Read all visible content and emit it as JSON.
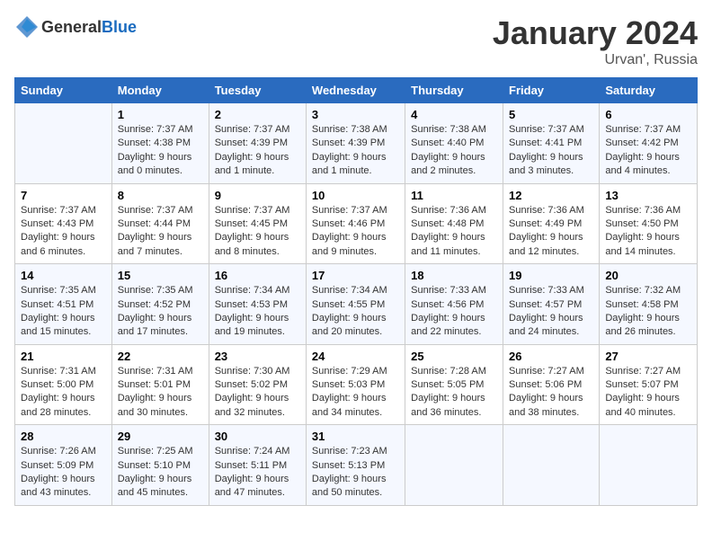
{
  "header": {
    "logo_general": "General",
    "logo_blue": "Blue",
    "month": "January 2024",
    "location": "Urvan', Russia"
  },
  "days_of_week": [
    "Sunday",
    "Monday",
    "Tuesday",
    "Wednesday",
    "Thursday",
    "Friday",
    "Saturday"
  ],
  "weeks": [
    [
      {
        "day": "",
        "info": ""
      },
      {
        "day": "1",
        "info": "Sunrise: 7:37 AM\nSunset: 4:38 PM\nDaylight: 9 hours\nand 0 minutes."
      },
      {
        "day": "2",
        "info": "Sunrise: 7:37 AM\nSunset: 4:39 PM\nDaylight: 9 hours\nand 1 minute."
      },
      {
        "day": "3",
        "info": "Sunrise: 7:38 AM\nSunset: 4:39 PM\nDaylight: 9 hours\nand 1 minute."
      },
      {
        "day": "4",
        "info": "Sunrise: 7:38 AM\nSunset: 4:40 PM\nDaylight: 9 hours\nand 2 minutes."
      },
      {
        "day": "5",
        "info": "Sunrise: 7:37 AM\nSunset: 4:41 PM\nDaylight: 9 hours\nand 3 minutes."
      },
      {
        "day": "6",
        "info": "Sunrise: 7:37 AM\nSunset: 4:42 PM\nDaylight: 9 hours\nand 4 minutes."
      }
    ],
    [
      {
        "day": "7",
        "info": "Sunrise: 7:37 AM\nSunset: 4:43 PM\nDaylight: 9 hours\nand 6 minutes."
      },
      {
        "day": "8",
        "info": "Sunrise: 7:37 AM\nSunset: 4:44 PM\nDaylight: 9 hours\nand 7 minutes."
      },
      {
        "day": "9",
        "info": "Sunrise: 7:37 AM\nSunset: 4:45 PM\nDaylight: 9 hours\nand 8 minutes."
      },
      {
        "day": "10",
        "info": "Sunrise: 7:37 AM\nSunset: 4:46 PM\nDaylight: 9 hours\nand 9 minutes."
      },
      {
        "day": "11",
        "info": "Sunrise: 7:36 AM\nSunset: 4:48 PM\nDaylight: 9 hours\nand 11 minutes."
      },
      {
        "day": "12",
        "info": "Sunrise: 7:36 AM\nSunset: 4:49 PM\nDaylight: 9 hours\nand 12 minutes."
      },
      {
        "day": "13",
        "info": "Sunrise: 7:36 AM\nSunset: 4:50 PM\nDaylight: 9 hours\nand 14 minutes."
      }
    ],
    [
      {
        "day": "14",
        "info": "Sunrise: 7:35 AM\nSunset: 4:51 PM\nDaylight: 9 hours\nand 15 minutes."
      },
      {
        "day": "15",
        "info": "Sunrise: 7:35 AM\nSunset: 4:52 PM\nDaylight: 9 hours\nand 17 minutes."
      },
      {
        "day": "16",
        "info": "Sunrise: 7:34 AM\nSunset: 4:53 PM\nDaylight: 9 hours\nand 19 minutes."
      },
      {
        "day": "17",
        "info": "Sunrise: 7:34 AM\nSunset: 4:55 PM\nDaylight: 9 hours\nand 20 minutes."
      },
      {
        "day": "18",
        "info": "Sunrise: 7:33 AM\nSunset: 4:56 PM\nDaylight: 9 hours\nand 22 minutes."
      },
      {
        "day": "19",
        "info": "Sunrise: 7:33 AM\nSunset: 4:57 PM\nDaylight: 9 hours\nand 24 minutes."
      },
      {
        "day": "20",
        "info": "Sunrise: 7:32 AM\nSunset: 4:58 PM\nDaylight: 9 hours\nand 26 minutes."
      }
    ],
    [
      {
        "day": "21",
        "info": "Sunrise: 7:31 AM\nSunset: 5:00 PM\nDaylight: 9 hours\nand 28 minutes."
      },
      {
        "day": "22",
        "info": "Sunrise: 7:31 AM\nSunset: 5:01 PM\nDaylight: 9 hours\nand 30 minutes."
      },
      {
        "day": "23",
        "info": "Sunrise: 7:30 AM\nSunset: 5:02 PM\nDaylight: 9 hours\nand 32 minutes."
      },
      {
        "day": "24",
        "info": "Sunrise: 7:29 AM\nSunset: 5:03 PM\nDaylight: 9 hours\nand 34 minutes."
      },
      {
        "day": "25",
        "info": "Sunrise: 7:28 AM\nSunset: 5:05 PM\nDaylight: 9 hours\nand 36 minutes."
      },
      {
        "day": "26",
        "info": "Sunrise: 7:27 AM\nSunset: 5:06 PM\nDaylight: 9 hours\nand 38 minutes."
      },
      {
        "day": "27",
        "info": "Sunrise: 7:27 AM\nSunset: 5:07 PM\nDaylight: 9 hours\nand 40 minutes."
      }
    ],
    [
      {
        "day": "28",
        "info": "Sunrise: 7:26 AM\nSunset: 5:09 PM\nDaylight: 9 hours\nand 43 minutes."
      },
      {
        "day": "29",
        "info": "Sunrise: 7:25 AM\nSunset: 5:10 PM\nDaylight: 9 hours\nand 45 minutes."
      },
      {
        "day": "30",
        "info": "Sunrise: 7:24 AM\nSunset: 5:11 PM\nDaylight: 9 hours\nand 47 minutes."
      },
      {
        "day": "31",
        "info": "Sunrise: 7:23 AM\nSunset: 5:13 PM\nDaylight: 9 hours\nand 50 minutes."
      },
      {
        "day": "",
        "info": ""
      },
      {
        "day": "",
        "info": ""
      },
      {
        "day": "",
        "info": ""
      }
    ]
  ]
}
